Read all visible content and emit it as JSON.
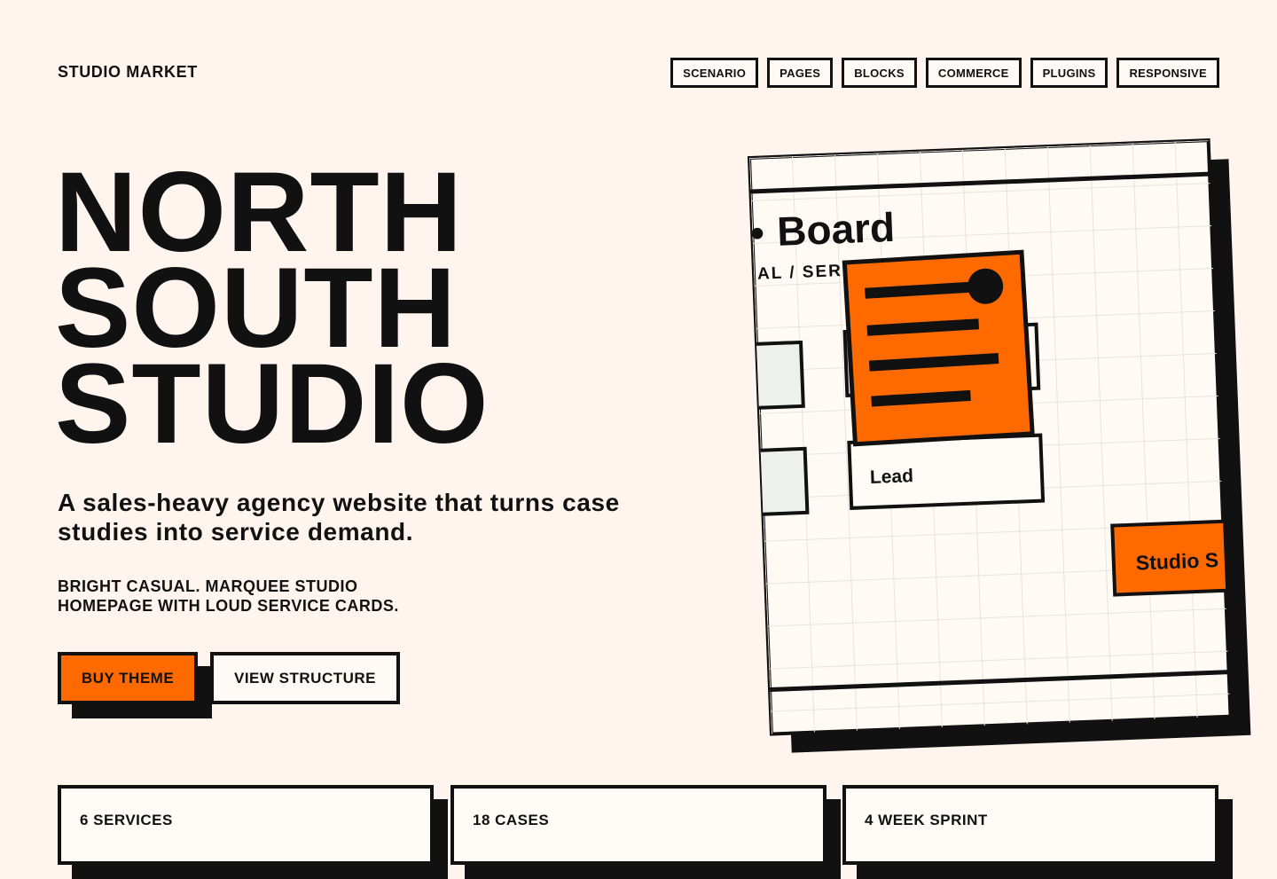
{
  "header": {
    "brand": "STUDIO MARKET",
    "nav": [
      "SCENARIO",
      "PAGES",
      "BLOCKS",
      "COMMERCE",
      "PLUGINS",
      "RESPONSIVE"
    ]
  },
  "hero": {
    "title_lines": [
      "NORTH",
      "SOUTH",
      "STUDIO"
    ],
    "lead": "A sales-heavy agency website that turns case studies into service demand.",
    "kicker": "BRIGHT CASUAL. MARQUEE STUDIO HOMEPAGE WITH LOUD SERVICE CARDS.",
    "primary_cta": "BUY THEME",
    "secondary_cta": "VIEW STRUCTURE"
  },
  "illustration": {
    "board_title": "Board",
    "board_subtitle": "AL / SER",
    "card_label": "Lead",
    "tag_label": "Studio S"
  },
  "stats": [
    "6 SERVICES",
    "18 CASES",
    "4 WEEK SPRINT"
  ],
  "colors": {
    "background": "#fff5ee",
    "accent": "#ff6a00",
    "ink": "#111111"
  }
}
